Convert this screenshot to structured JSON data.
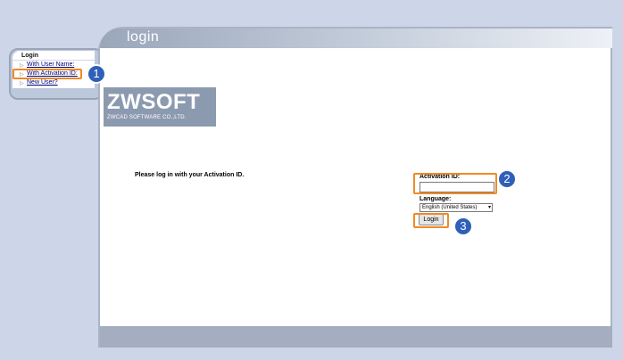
{
  "nav": {
    "title": "Login",
    "items": [
      {
        "label": "With User Name:"
      },
      {
        "label": "With Activation ID:"
      },
      {
        "label": "New User?"
      }
    ]
  },
  "window": {
    "title": "login"
  },
  "logo": {
    "main": "ZWSOFT",
    "sub": "ZWCAD SOFTWARE CO.,LTD."
  },
  "prompt": "Please log in with your Activation ID.",
  "form": {
    "activation_label": "Activation ID:",
    "activation_value": "",
    "language_label": "Language:",
    "language_selected": "English (United States)",
    "login_button": "Login"
  },
  "callouts": [
    "1",
    "2",
    "3"
  ],
  "colors": {
    "highlight": "#f08a24",
    "callout": "#2f5fb8",
    "background": "#ccd6e8"
  }
}
